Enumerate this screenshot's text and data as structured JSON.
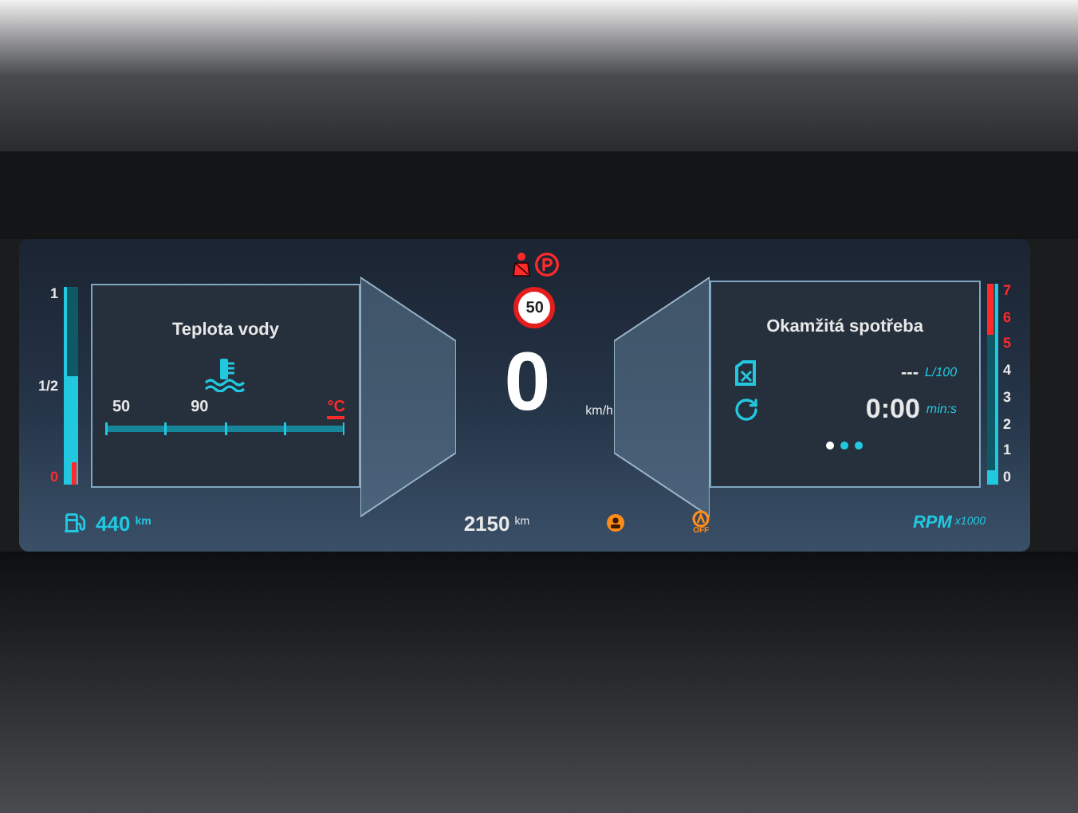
{
  "fuel_gauge": {
    "ticks": [
      {
        "label": "1",
        "color": "#e8e8e8"
      },
      {
        "label": "1/2",
        "color": "#e8e8e8"
      },
      {
        "label": "0",
        "color": "#ff2a2a"
      }
    ],
    "level": 0.55
  },
  "left_panel": {
    "title": "Teplota vody",
    "scale": [
      "50",
      "90"
    ],
    "unit": "°C"
  },
  "range": {
    "value": "440",
    "unit": "km"
  },
  "speed_limit": "50",
  "speed": {
    "value": "0",
    "unit": "km/h"
  },
  "odometer": {
    "value": "2150",
    "unit": "km"
  },
  "off_indicator": {
    "label": "OFF"
  },
  "right_panel": {
    "title": "Okamžitá spotřeba",
    "consumption": {
      "value": "---",
      "unit": "L/100"
    },
    "stop_time": {
      "value": "0:00",
      "unit": "min:s"
    },
    "pages": [
      {
        "selected": true
      },
      {
        "selected": false
      },
      {
        "selected": false
      }
    ]
  },
  "rpm_gauge": {
    "ticks": [
      {
        "label": "7",
        "color": "#ff2a2a"
      },
      {
        "label": "6",
        "color": "#ff2a2a"
      },
      {
        "label": "5",
        "color": "#ff2a2a"
      },
      {
        "label": "4",
        "color": "#e8e8e8"
      },
      {
        "label": "3",
        "color": "#e8e8e8"
      },
      {
        "label": "2",
        "color": "#e8e8e8"
      },
      {
        "label": "1",
        "color": "#e8e8e8"
      },
      {
        "label": "0",
        "color": "#e8e8e8"
      }
    ],
    "level": 0.07,
    "label": "RPM",
    "unit": "x1000"
  }
}
